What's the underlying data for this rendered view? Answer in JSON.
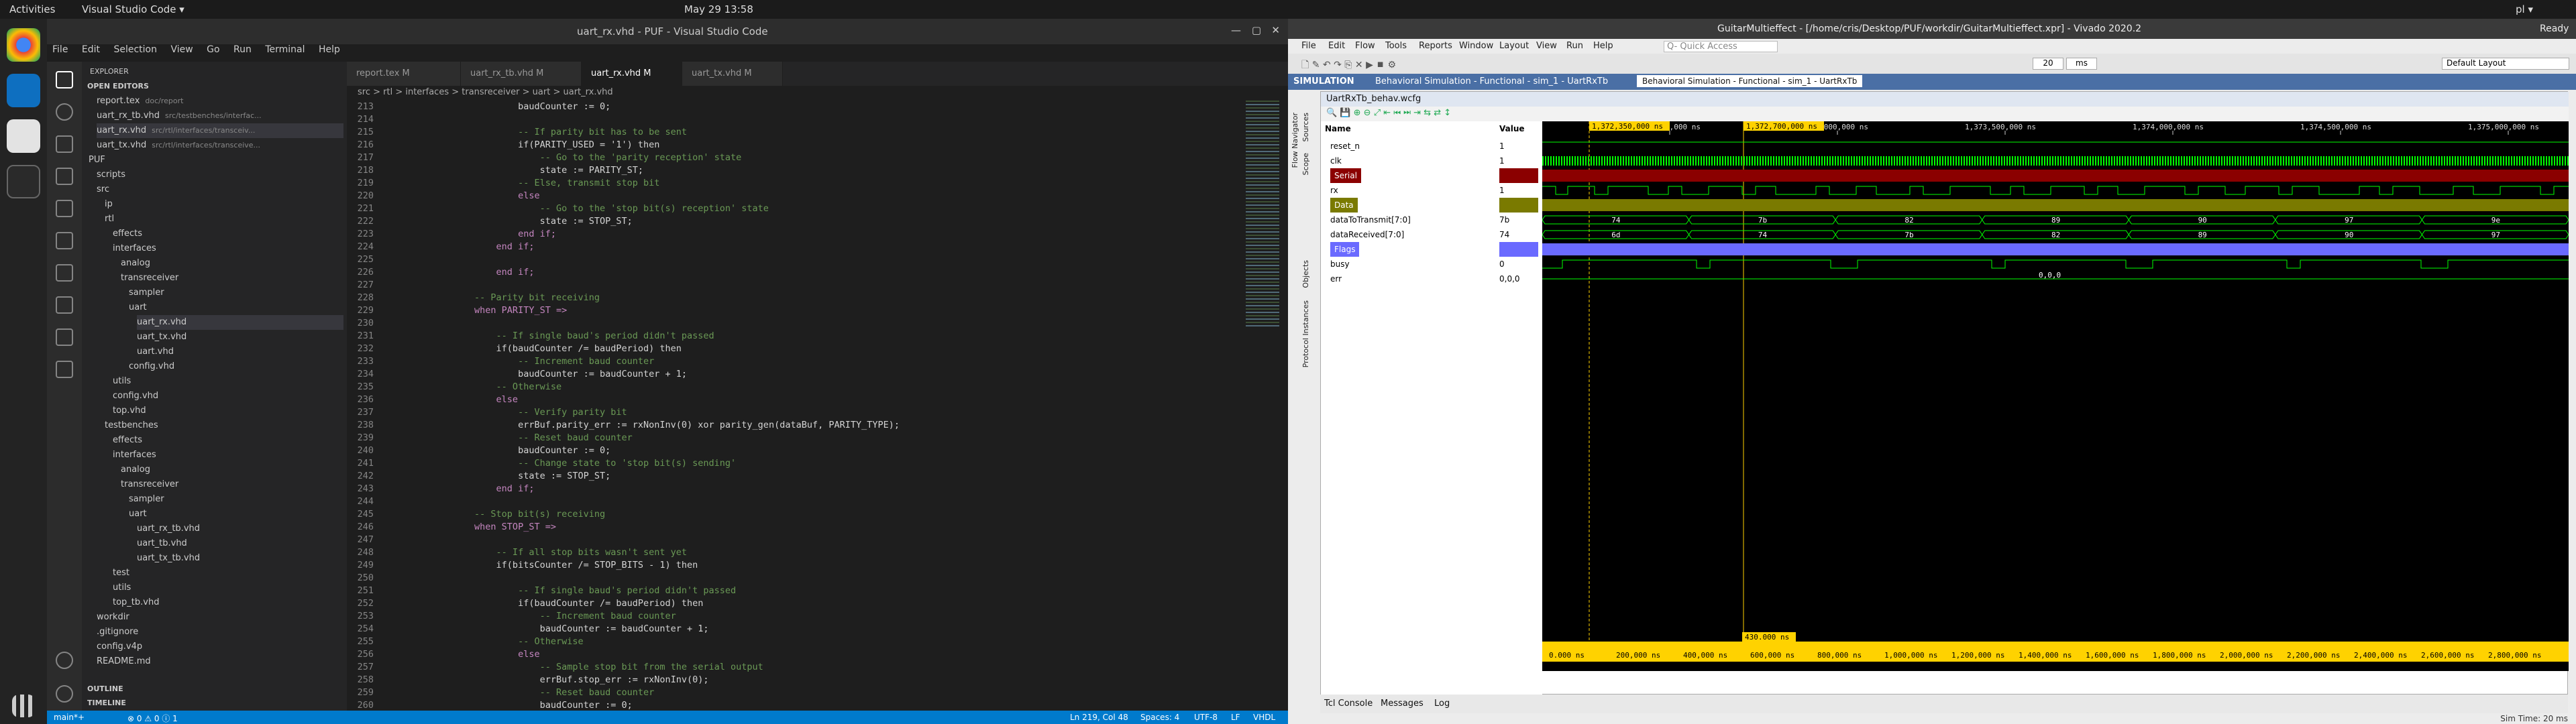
{
  "topbar": {
    "activities": "Activities",
    "app": "Visual Studio Code ▾",
    "clock": "May 29 13:58",
    "lang": "pl ▾"
  },
  "vscode": {
    "title": "uart_rx.vhd - PUF - Visual Studio Code",
    "menu": [
      "File",
      "Edit",
      "Selection",
      "View",
      "Go",
      "Run",
      "Terminal",
      "Help"
    ],
    "explorer": {
      "header": "EXPLORER",
      "open_editors": "OPEN EDITORS",
      "rows": [
        {
          "t": "report.tex",
          "d": "doc/report",
          "i": 1
        },
        {
          "t": "uart_rx_tb.vhd",
          "d": "src/testbenches/interfac...",
          "i": 1
        },
        {
          "t": "uart_rx.vhd",
          "d": "src/rtl/interfaces/transceiv...",
          "i": 1,
          "sel": true
        },
        {
          "t": "uart_tx.vhd",
          "d": "src/rtl/interfaces/transceive...",
          "i": 1
        },
        {
          "t": "PUF",
          "i": 0
        },
        {
          "t": "scripts",
          "i": 1
        },
        {
          "t": "src",
          "i": 1
        },
        {
          "t": "ip",
          "i": 2
        },
        {
          "t": "rtl",
          "i": 2
        },
        {
          "t": "effects",
          "i": 3
        },
        {
          "t": "interfaces",
          "i": 3
        },
        {
          "t": "analog",
          "i": 4
        },
        {
          "t": "transreceiver",
          "i": 4
        },
        {
          "t": "sampler",
          "i": 5
        },
        {
          "t": "uart",
          "i": 5
        },
        {
          "t": "uart_rx.vhd",
          "i": 6,
          "sel": true
        },
        {
          "t": "uart_tx.vhd",
          "i": 6
        },
        {
          "t": "uart.vhd",
          "i": 6
        },
        {
          "t": "config.vhd",
          "i": 5
        },
        {
          "t": "utils",
          "i": 3
        },
        {
          "t": "config.vhd",
          "i": 3
        },
        {
          "t": "top.vhd",
          "i": 3
        },
        {
          "t": "testbenches",
          "i": 2
        },
        {
          "t": "effects",
          "i": 3
        },
        {
          "t": "interfaces",
          "i": 3
        },
        {
          "t": "analog",
          "i": 4
        },
        {
          "t": "transreceiver",
          "i": 4
        },
        {
          "t": "sampler",
          "i": 5
        },
        {
          "t": "uart",
          "i": 5
        },
        {
          "t": "uart_rx_tb.vhd",
          "i": 6
        },
        {
          "t": "uart_tb.vhd",
          "i": 6
        },
        {
          "t": "uart_tx_tb.vhd",
          "i": 6
        },
        {
          "t": "test",
          "i": 3
        },
        {
          "t": "utils",
          "i": 3
        },
        {
          "t": "top_tb.vhd",
          "i": 3
        },
        {
          "t": "workdir",
          "i": 1
        },
        {
          "t": ".gitignore",
          "i": 1
        },
        {
          "t": "config.v4p",
          "i": 1
        },
        {
          "t": "README.md",
          "i": 1
        }
      ],
      "outline": "OUTLINE",
      "timeline": "TIMELINE"
    },
    "tabs": [
      "report.tex M",
      "uart_rx_tb.vhd M",
      "uart_rx.vhd M",
      "uart_tx.vhd M"
    ],
    "breadcrumb": "src > rtl > interfaces > transreceiver > uart > uart_rx.vhd",
    "status": {
      "branch": "main*+",
      "errors": "⊗ 0 ⚠ 0 ⓘ 1",
      "pos": "Ln 219, Col 48",
      "spaces": "Spaces: 4",
      "enc": "UTF-8",
      "eol": "LF",
      "lang": "VHDL"
    }
  },
  "code": [
    {
      "n": "213",
      "t": "                        baudCounter := 0;",
      "c": "tx"
    },
    {
      "n": "214",
      "t": "",
      "c": "tx"
    },
    {
      "n": "215",
      "t": "                        -- If parity bit has to be sent",
      "c": "cm"
    },
    {
      "n": "216",
      "t": "                        if(PARITY_USED = '1') then",
      "c": "tx"
    },
    {
      "n": "217",
      "t": "                            -- Go to the 'parity reception' state",
      "c": "cm"
    },
    {
      "n": "218",
      "t": "                            state := PARITY_ST;",
      "c": "tx"
    },
    {
      "n": "219",
      "t": "                        -- Else, transmit stop bit",
      "c": "cm"
    },
    {
      "n": "220",
      "t": "                        else",
      "c": "kw"
    },
    {
      "n": "221",
      "t": "                            -- Go to the 'stop bit(s) reception' state",
      "c": "cm"
    },
    {
      "n": "222",
      "t": "                            state := STOP_ST;",
      "c": "tx"
    },
    {
      "n": "223",
      "t": "                        end if;",
      "c": "kw"
    },
    {
      "n": "224",
      "t": "                    end if;",
      "c": "kw"
    },
    {
      "n": "225",
      "t": "",
      "c": "tx"
    },
    {
      "n": "226",
      "t": "                    end if;",
      "c": "kw"
    },
    {
      "n": "227",
      "t": "",
      "c": "tx"
    },
    {
      "n": "228",
      "t": "                -- Parity bit receiving",
      "c": "cm"
    },
    {
      "n": "229",
      "t": "                when PARITY_ST =>",
      "c": "kw"
    },
    {
      "n": "230",
      "t": "",
      "c": "tx"
    },
    {
      "n": "231",
      "t": "                    -- If single baud's period didn't passed",
      "c": "cm"
    },
    {
      "n": "232",
      "t": "                    if(baudCounter /= baudPeriod) then",
      "c": "tx"
    },
    {
      "n": "233",
      "t": "                        -- Increment baud counter",
      "c": "cm"
    },
    {
      "n": "234",
      "t": "                        baudCounter := baudCounter + 1;",
      "c": "tx"
    },
    {
      "n": "235",
      "t": "                    -- Otherwise",
      "c": "cm"
    },
    {
      "n": "236",
      "t": "                    else",
      "c": "kw"
    },
    {
      "n": "237",
      "t": "                        -- Verify parity bit",
      "c": "cm"
    },
    {
      "n": "238",
      "t": "                        errBuf.parity_err := rxNonInv(0) xor parity_gen(dataBuf, PARITY_TYPE);",
      "c": "tx"
    },
    {
      "n": "239",
      "t": "                        -- Reset baud counter",
      "c": "cm"
    },
    {
      "n": "240",
      "t": "                        baudCounter := 0;",
      "c": "tx"
    },
    {
      "n": "241",
      "t": "                        -- Change state to 'stop bit(s) sending'",
      "c": "cm"
    },
    {
      "n": "242",
      "t": "                        state := STOP_ST;",
      "c": "tx"
    },
    {
      "n": "243",
      "t": "                    end if;",
      "c": "kw"
    },
    {
      "n": "244",
      "t": "",
      "c": "tx"
    },
    {
      "n": "245",
      "t": "                -- Stop bit(s) receiving",
      "c": "cm"
    },
    {
      "n": "246",
      "t": "                when STOP_ST =>",
      "c": "kw"
    },
    {
      "n": "247",
      "t": "",
      "c": "tx"
    },
    {
      "n": "248",
      "t": "                    -- If all stop bits wasn't sent yet",
      "c": "cm"
    },
    {
      "n": "249",
      "t": "                    if(bitsCounter /= STOP_BITS - 1) then",
      "c": "tx"
    },
    {
      "n": "250",
      "t": "",
      "c": "tx"
    },
    {
      "n": "251",
      "t": "                        -- If single baud's period didn't passed",
      "c": "cm"
    },
    {
      "n": "252",
      "t": "                        if(baudCounter /= baudPeriod) then",
      "c": "tx"
    },
    {
      "n": "253",
      "t": "                            -- Increment baud counter",
      "c": "cm"
    },
    {
      "n": "254",
      "t": "                            baudCounter := baudCounter + 1;",
      "c": "tx"
    },
    {
      "n": "255",
      "t": "                        -- Otherwise",
      "c": "cm"
    },
    {
      "n": "256",
      "t": "                        else",
      "c": "kw"
    },
    {
      "n": "257",
      "t": "                            -- Sample stop bit from the serial output",
      "c": "cm"
    },
    {
      "n": "258",
      "t": "                            errBuf.stop_err := rxNonInv(0);",
      "c": "tx"
    },
    {
      "n": "259",
      "t": "                            -- Reset baud counter",
      "c": "cm"
    },
    {
      "n": "260",
      "t": "                            baudCounter := 0;",
      "c": "tx"
    }
  ],
  "vivado": {
    "title": "GuitarMultieffect - [/home/cris/Desktop/PUF/workdir/GuitarMultieffect.xpr] - Vivado 2020.2",
    "ready": "Ready",
    "menu": [
      "File",
      "Edit",
      "Flow",
      "Tools",
      "Reports",
      "Window",
      "Layout",
      "View",
      "Run",
      "Help"
    ],
    "quick_access": "Q- Quick Access",
    "run_time": "20",
    "run_unit": "ms",
    "layout": "Default Layout",
    "flow_label": "SIMULATION",
    "flow_sub": "Behavioral Simulation - Functional - sim_1 - UartRxTb",
    "tab": "Behavioral Simulation - Functional - sim_1 - UartRxTb",
    "wcfg": "UartRxTb_behav.wcfg",
    "side_tabs": [
      "Flow Navigator",
      "Sources",
      "Scope",
      "Objects",
      "Protocol Instances"
    ],
    "col_name": "Name",
    "col_value": "Value",
    "cursor_a": "1,372,350,000 ns",
    "cursor_b": "1,372,700,000 ns",
    "ruler": [
      "1,372,500,000 ns",
      "1,373,000,000 ns",
      "1,373,500,000 ns",
      "1,374,000,000 ns",
      "1,374,500,000 ns",
      "1,375,000,000 ns"
    ],
    "bottom_ruler": [
      "0.000 ns",
      "200,000 ns",
      "400,000 ns",
      "600,000 ns",
      "800,000 ns",
      "1,000,000 ns",
      "1,200,000 ns",
      "1,400,000 ns",
      "1,600,000 ns",
      "1,800,000 ns",
      "2,000,000 ns",
      "2,200,000 ns",
      "2,400,000 ns",
      "2,600,000 ns",
      "2,800,000 ns"
    ],
    "delta": "430.000 ns",
    "signals": [
      {
        "name": "reset_n",
        "value": "1"
      },
      {
        "name": "clk",
        "value": "1"
      },
      {
        "name": "Serial",
        "value": ""
      },
      {
        "name": "rx",
        "value": "1"
      },
      {
        "name": "Data",
        "value": ""
      },
      {
        "name": "dataToTransmit[7:0]",
        "value": "7b"
      },
      {
        "name": "dataReceived[7:0]",
        "value": "74"
      },
      {
        "name": "Flags",
        "value": ""
      },
      {
        "name": "busy",
        "value": "0"
      },
      {
        "name": "err",
        "value": "0,0,0"
      }
    ],
    "tx_values": [
      "74",
      "7b",
      "82",
      "89",
      "90",
      "97",
      "9e"
    ],
    "rx_values": [
      "6d",
      "74",
      "7b",
      "82",
      "89",
      "90",
      "97"
    ],
    "err_value": "0,0,0",
    "bottom_tabs": [
      "Tcl Console",
      "Messages",
      "Log"
    ],
    "sim_time": "Sim Time: 20 ms"
  }
}
